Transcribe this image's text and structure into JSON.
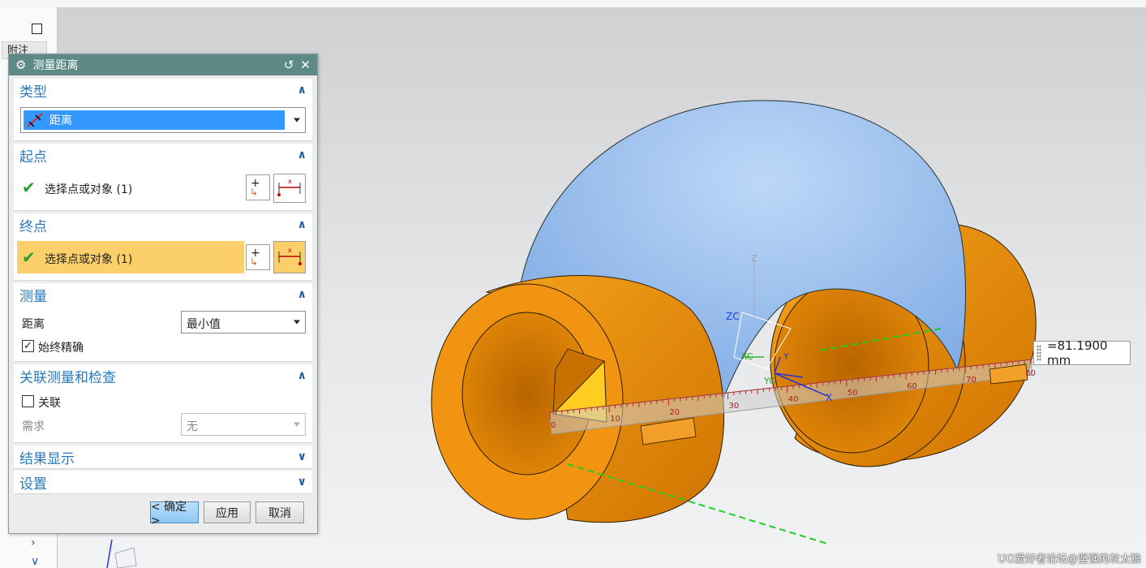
{
  "sidebar": {
    "notes_tab": "附注"
  },
  "dialog": {
    "title": "测量距离",
    "type_section": {
      "title": "类型",
      "selected": "距离"
    },
    "start_section": {
      "title": "起点",
      "select_label": "选择点或对象 (1)"
    },
    "end_section": {
      "title": "终点",
      "select_label": "选择点或对象 (1)"
    },
    "measure_section": {
      "title": "测量",
      "distance_label": "距离",
      "distance_value": "最小值",
      "always_precise_label": "始终精确",
      "always_precise_checked": true
    },
    "assoc_section": {
      "title": "关联测量和检查",
      "assoc_label": "关联",
      "assoc_checked": false,
      "require_label": "需求",
      "require_value": "无"
    },
    "result_section": {
      "title": "结果显示"
    },
    "settings_section": {
      "title": "设置"
    },
    "buttons": {
      "ok": "< 确定 >",
      "apply": "应用",
      "cancel": "取消"
    }
  },
  "viewport": {
    "measurement": "=81.1900 mm",
    "ruler_ticks": [
      "0",
      "10",
      "20",
      "30",
      "40",
      "50",
      "60",
      "70",
      "80"
    ],
    "axis_labels": {
      "zc": "ZC",
      "xc": "XC",
      "yc": "YC",
      "z": "Z",
      "x": "X",
      "y": "Y"
    }
  },
  "watermark": "UG爱好者论坛@坚强的灰太狼",
  "colors": {
    "part_orange": "#f0950f",
    "part_blue": "#9cc2ef",
    "dialog_title": "#5e8a86",
    "accent": "#2a78b8"
  }
}
